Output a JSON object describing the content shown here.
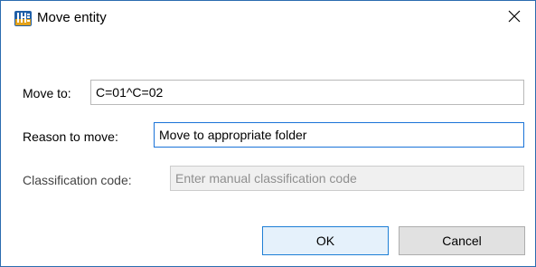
{
  "dialog": {
    "title": "Move entity",
    "app_icon": "ihs-logo-icon",
    "close_icon": "close-icon"
  },
  "form": {
    "move_to": {
      "label": "Move to:",
      "value": "C=01^C=02"
    },
    "reason": {
      "label": "Reason to move:",
      "value": "Move to appropriate folder"
    },
    "classification": {
      "label": "Classification code:",
      "value": "",
      "placeholder": "Enter manual classification code",
      "disabled": true
    }
  },
  "buttons": {
    "ok_label": "OK",
    "cancel_label": "Cancel"
  },
  "colors": {
    "window_border": "#2b6cb0",
    "focus_border": "#1a73d8",
    "ok_button_bg": "#e5f1fb",
    "ok_button_border": "#1e7fd6"
  }
}
